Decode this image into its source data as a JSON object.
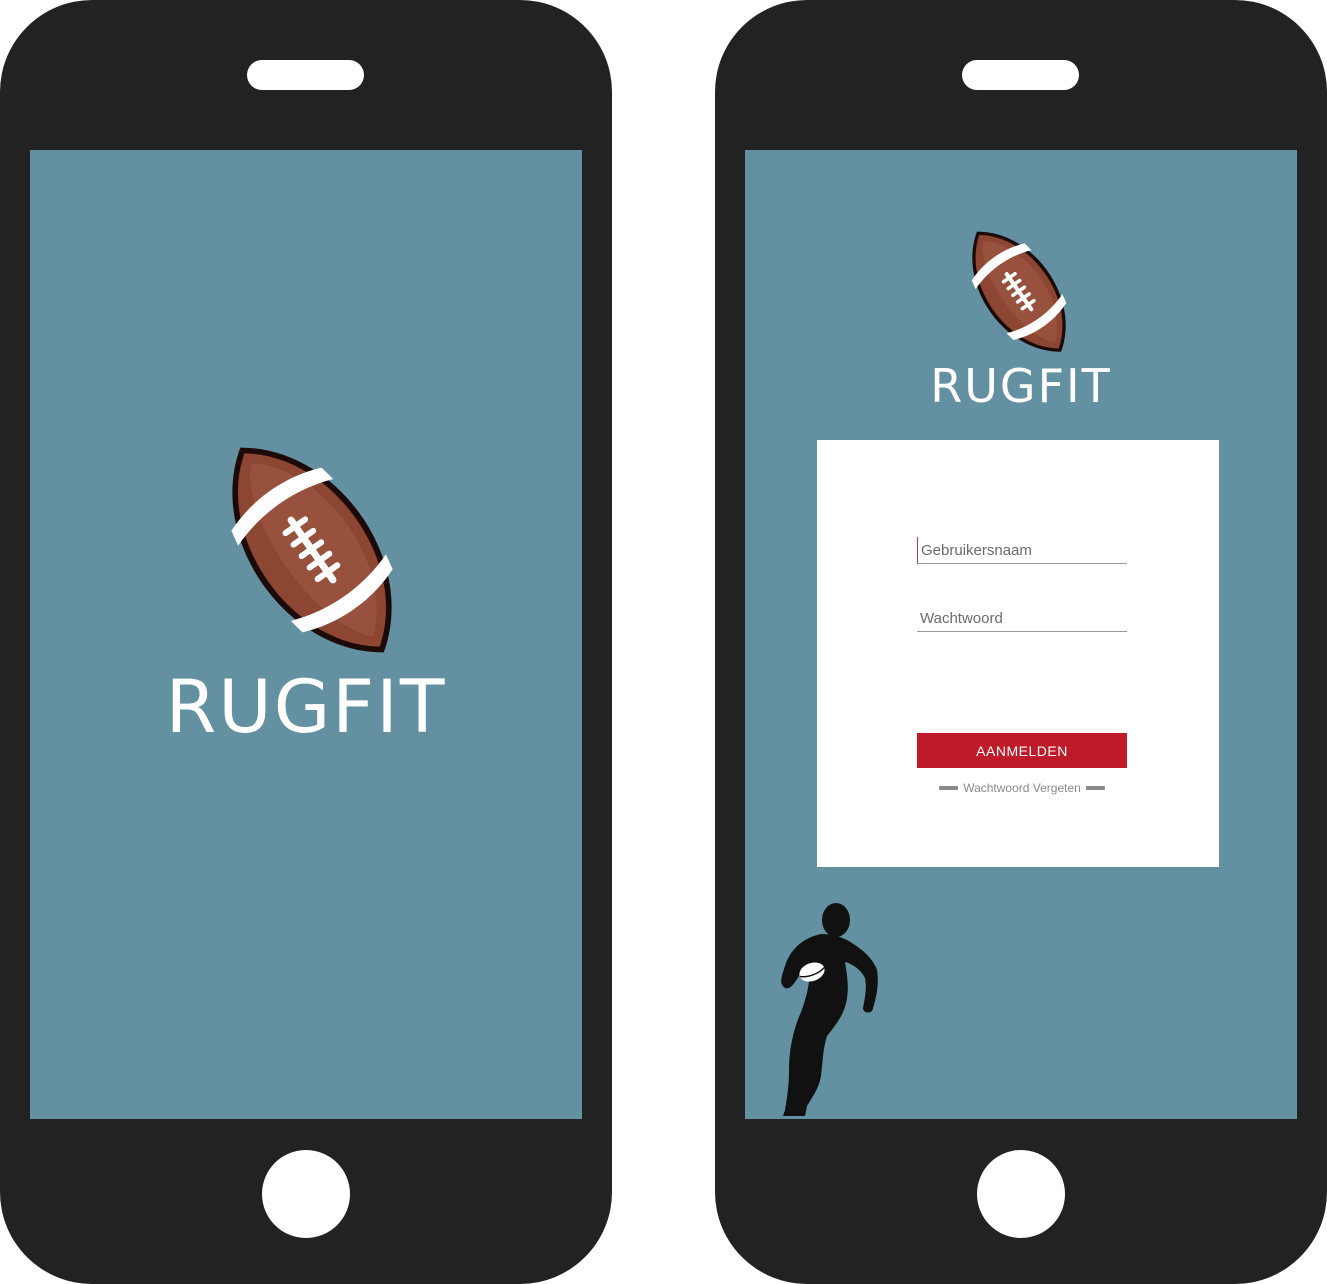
{
  "splash_screen": {
    "brand": "RUGFIT",
    "logo_icon": "rugby-ball-icon",
    "background_color": "#6391a2"
  },
  "login_screen": {
    "brand": "RUGFIT",
    "logo_icon": "rugby-ball-icon",
    "username_placeholder": "Gebruikersnaam",
    "password_placeholder": "Wachtwoord",
    "login_button_label": "AANMELDEN",
    "forgot_password_label": "Wachtwoord Vergeten",
    "decor_icon": "rugby-player-silhouette-icon",
    "accent_color": "#be1a27",
    "background_color": "#6391a2"
  },
  "device": {
    "frame_color": "#222222"
  }
}
